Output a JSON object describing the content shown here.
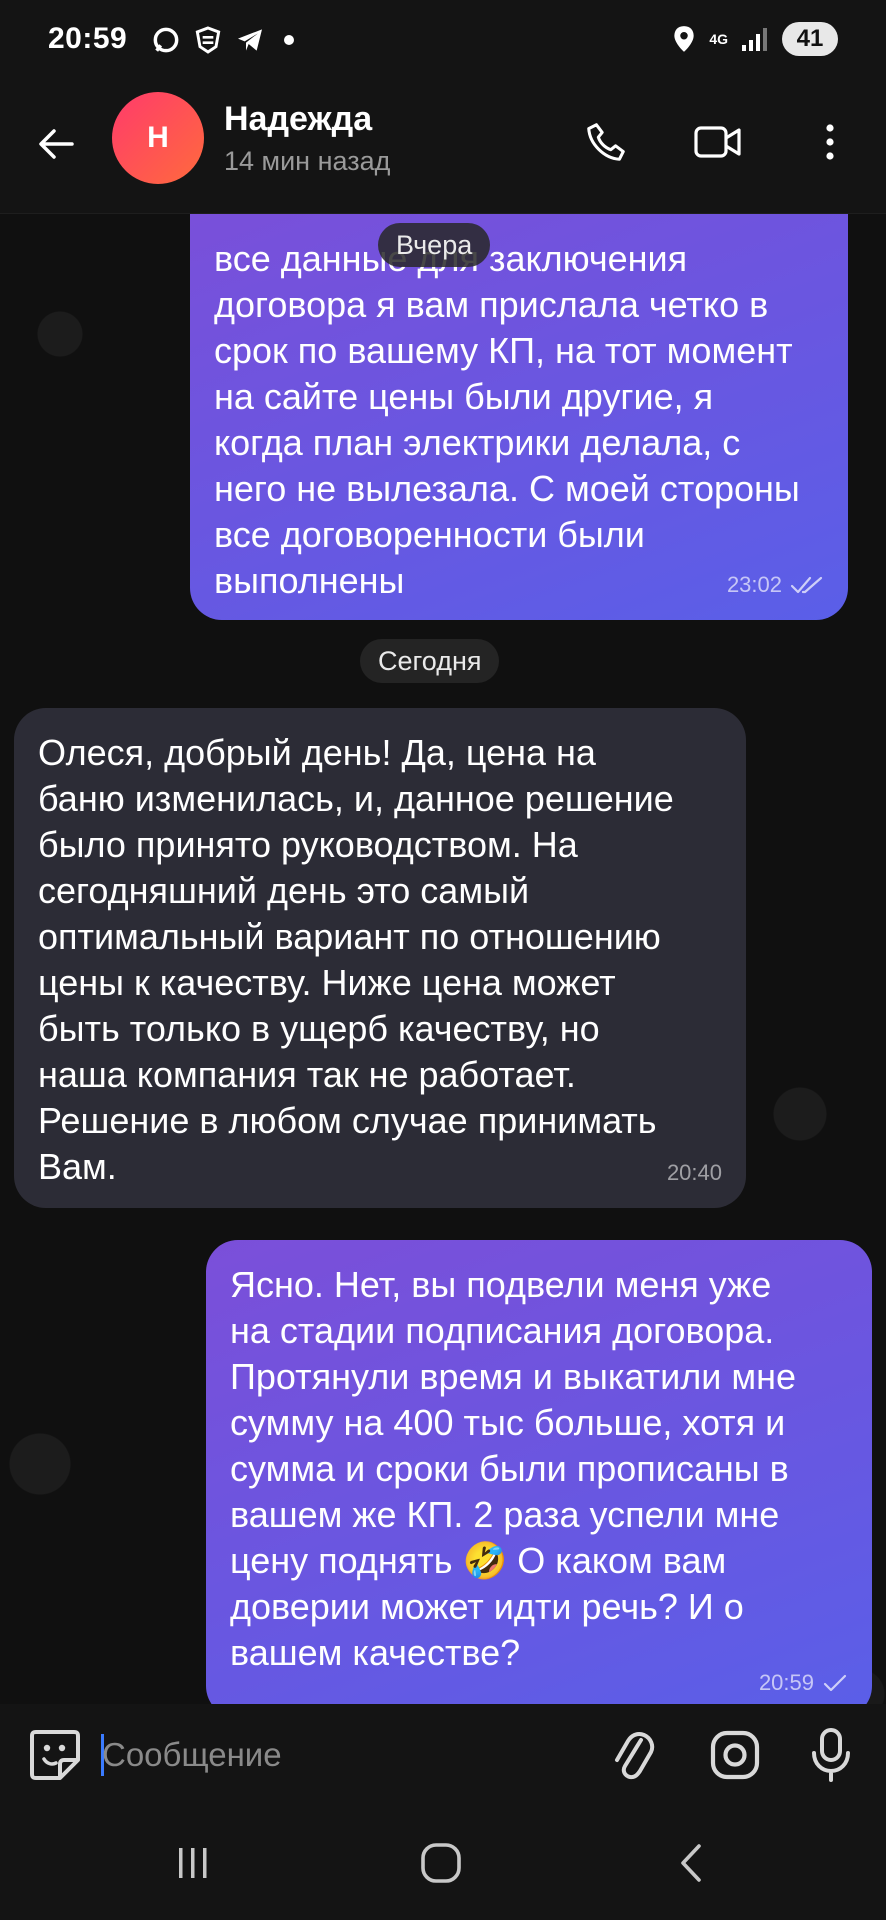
{
  "status_bar": {
    "time": "20:59",
    "network": "4G",
    "battery": "41"
  },
  "header": {
    "avatar_letter": "Н",
    "name": "Надежда",
    "last_seen": "14 мин назад"
  },
  "dates": {
    "yesterday": "Вчера",
    "today": "Сегодня"
  },
  "messages": [
    {
      "direction": "outgoing",
      "text": "все данные для заключения\nдоговора я вам прислала четко в\nсрок по вашему КП, на тот момент\nна сайте цены были другие, я\nкогда план электрики делала, с\nнего не вылезала. С моей стороны\nвсе договоренности были\nвыполнены",
      "time": "23:02",
      "status": "read"
    },
    {
      "direction": "incoming",
      "text": "Олеся, добрый день! Да, цена на\nбаню изменилась, и, данное решение\nбыло принято руководством. На\nсегодняшний день это самый\nоптимальный вариант по отношению\nцены к качеству. Ниже цена может\nбыть только в ущерб качеству, но\nнаша компания так не работает.\nРешение в любом случае принимать\nВам.",
      "time": "20:40"
    },
    {
      "direction": "outgoing",
      "text": "Ясно. Нет, вы подвели меня уже\nна стадии подписания договора.\nПротянули время и выкатили мне\nсумму на 400 тыс больше, хотя и\nсумма и сроки были прописаны в\nвашем же КП. 2 раза успели мне\nцену поднять 🤣 О каком вам\nдоверии может идти речь? И о\nвашем качестве?",
      "time": "20:59",
      "status": "sent"
    }
  ],
  "input": {
    "placeholder": "Сообщение",
    "value": ""
  },
  "colors": {
    "outgoing_bubble": "#6a56e0",
    "incoming_bubble": "#2c2c36",
    "background": "#101010",
    "avatar": "#ff4f5a",
    "cursor": "#3a7bff"
  },
  "icons": [
    "back-arrow-icon",
    "phone-icon",
    "video-camera-icon",
    "more-vertical-icon",
    "sticker-icon",
    "paperclip-icon",
    "camera-icon",
    "microphone-icon",
    "recents-icon",
    "home-icon",
    "back-nav-icon"
  ]
}
